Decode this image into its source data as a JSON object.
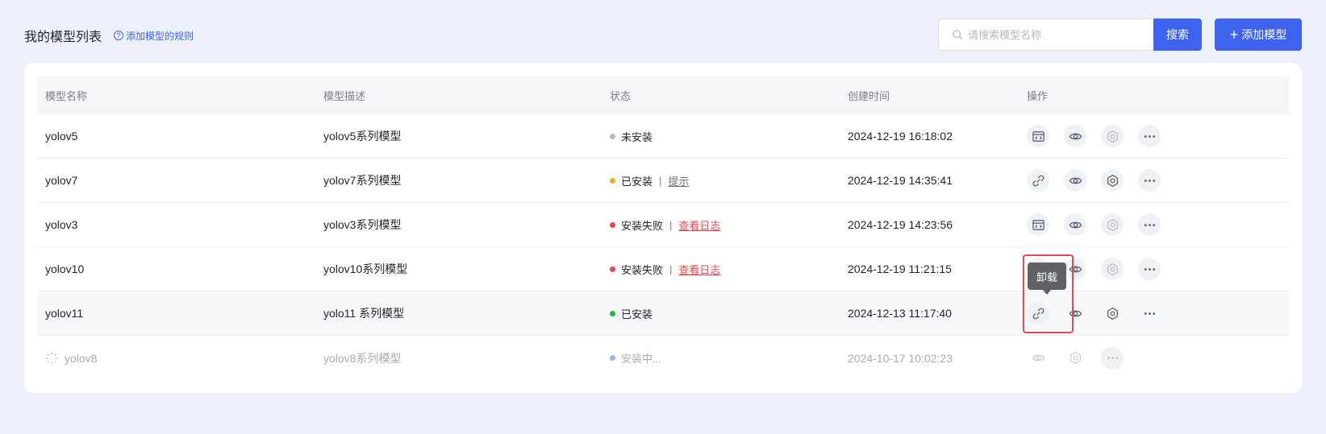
{
  "header": {
    "title": "我的模型列表",
    "rules_link": "添加模型的规则",
    "search_placeholder": "请搜索模型名称",
    "search_button": "搜索",
    "add_button": "添加模型"
  },
  "table": {
    "columns": [
      "模型名称",
      "模型描述",
      "状态",
      "创建时间",
      "操作"
    ],
    "rows": [
      {
        "name": "yolov5",
        "desc": "yolov5系列模型",
        "status": "未安装",
        "status_color": "#b4b9c6",
        "link": "",
        "time": "2024-12-19 16:18:02",
        "first_op": "code-window-icon"
      },
      {
        "name": "yolov7",
        "desc": "yolov7系列模型",
        "status": "已安装",
        "status_color": "#f5a623",
        "link": "提示",
        "time": "2024-12-19 14:35:41",
        "first_op": "unlink-icon"
      },
      {
        "name": "yolov3",
        "desc": "yolov3系列模型",
        "status": "安装失败",
        "status_color": "#e5484d",
        "link": "查看日志",
        "time": "2024-12-19 14:23:56",
        "first_op": "code-window-icon"
      },
      {
        "name": "yolov10",
        "desc": "yolov10系列模型",
        "status": "安装失败",
        "status_color": "#e5484d",
        "link": "查看日志",
        "time": "2024-12-19 11:21:15",
        "first_op": "code-window-icon"
      },
      {
        "name": "yolov11",
        "desc": "yolo11 系列模型",
        "status": "已安装",
        "status_color": "#2bb34b",
        "link": "",
        "time": "2024-12-13 11:17:40",
        "first_op": "unlink-icon"
      },
      {
        "name": "yolov8",
        "desc": "yolov8系列模型",
        "status": "安装中...",
        "status_color": "#9fb1e6",
        "link": "",
        "time": "2024-10-17 10:02:23",
        "first_op": ""
      }
    ]
  },
  "tooltip": "卸载",
  "colors": {
    "primary": "#3e63ee",
    "danger": "#e5484d",
    "background": "#eef1fb"
  }
}
